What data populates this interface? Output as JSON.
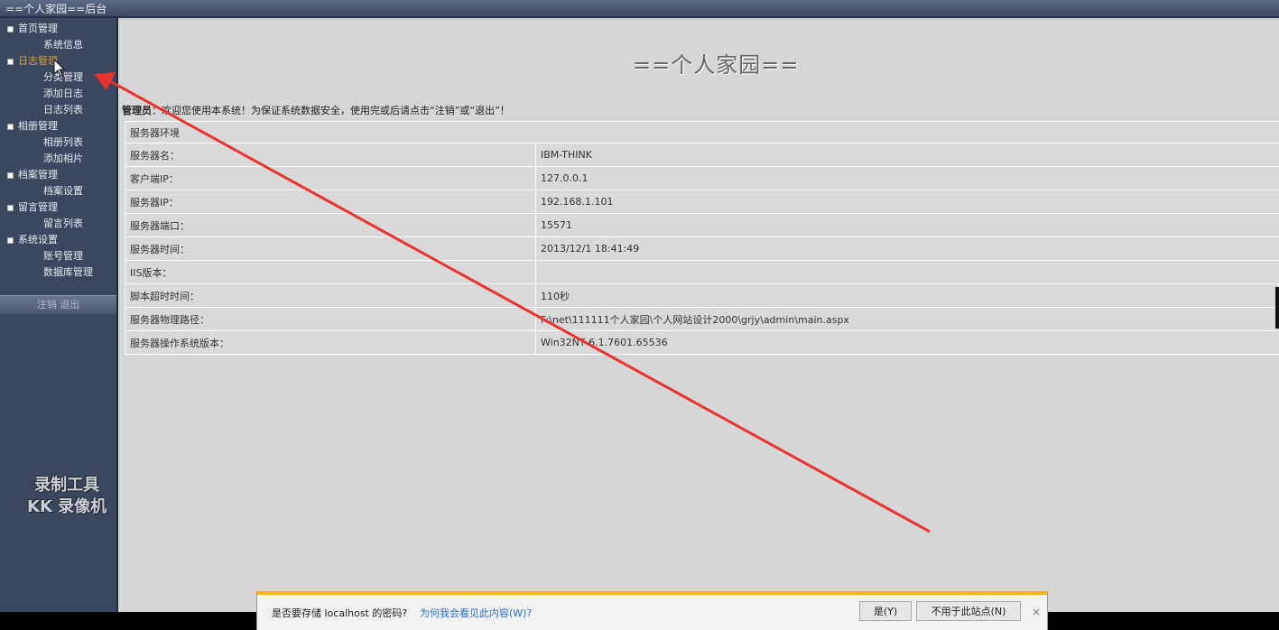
{
  "window_title": "==个人家园==后台",
  "sidebar": {
    "groups": [
      {
        "title": "首页管理",
        "items": [
          "系统信息"
        ]
      },
      {
        "title": "日志管理",
        "items": [
          "分类管理",
          "添加日志",
          "日志列表"
        ]
      },
      {
        "title": "相册管理",
        "items": [
          "相册列表",
          "添加相片"
        ]
      },
      {
        "title": "档案管理",
        "items": [
          "档案设置"
        ]
      },
      {
        "title": "留言管理",
        "items": [
          "留言列表"
        ]
      },
      {
        "title": "系统设置",
        "items": [
          "账号管理",
          "数据库管理"
        ]
      }
    ],
    "logout_text": "注销 退出",
    "watermark": [
      "录制工具",
      "KK 录像机"
    ]
  },
  "main": {
    "site_title": "==个人家园==",
    "welcome_user": "管理员",
    "welcome_text": "：欢迎您使用本系统！为保证系统数据安全，使用完或后请点击“注销”或“退出”！",
    "table_header": "服务器环境",
    "rows": [
      {
        "k": "服务器名：",
        "v": "IBM-THINK"
      },
      {
        "k": "客户端IP：",
        "v": "127.0.0.1"
      },
      {
        "k": "服务器IP：",
        "v": "192.168.1.101"
      },
      {
        "k": "服务器端口：",
        "v": "15571"
      },
      {
        "k": "服务器时间：",
        "v": "2013/12/1 18:41:49"
      },
      {
        "k": "IIS版本：",
        "v": ""
      },
      {
        "k": "脚本超时时间：",
        "v": "110秒"
      },
      {
        "k": "服务器物理路径：",
        "v": "F:\\net\\111111个人家园\\个人网站设计2000\\grjy\\admin\\main.aspx"
      },
      {
        "k": "服务器操作系统版本：",
        "v": "Win32NT 6.1.7601.65536"
      }
    ]
  },
  "password_bar": {
    "question": "是否要存储 localhost 的密码?",
    "link": "为何我会看见此内容(W)?",
    "yes": "是(Y)",
    "never": "不用于此站点(N)",
    "close": "×"
  },
  "colors": {
    "annotation_arrow": "#e8332e",
    "bar_accent": "#f3b21b"
  }
}
